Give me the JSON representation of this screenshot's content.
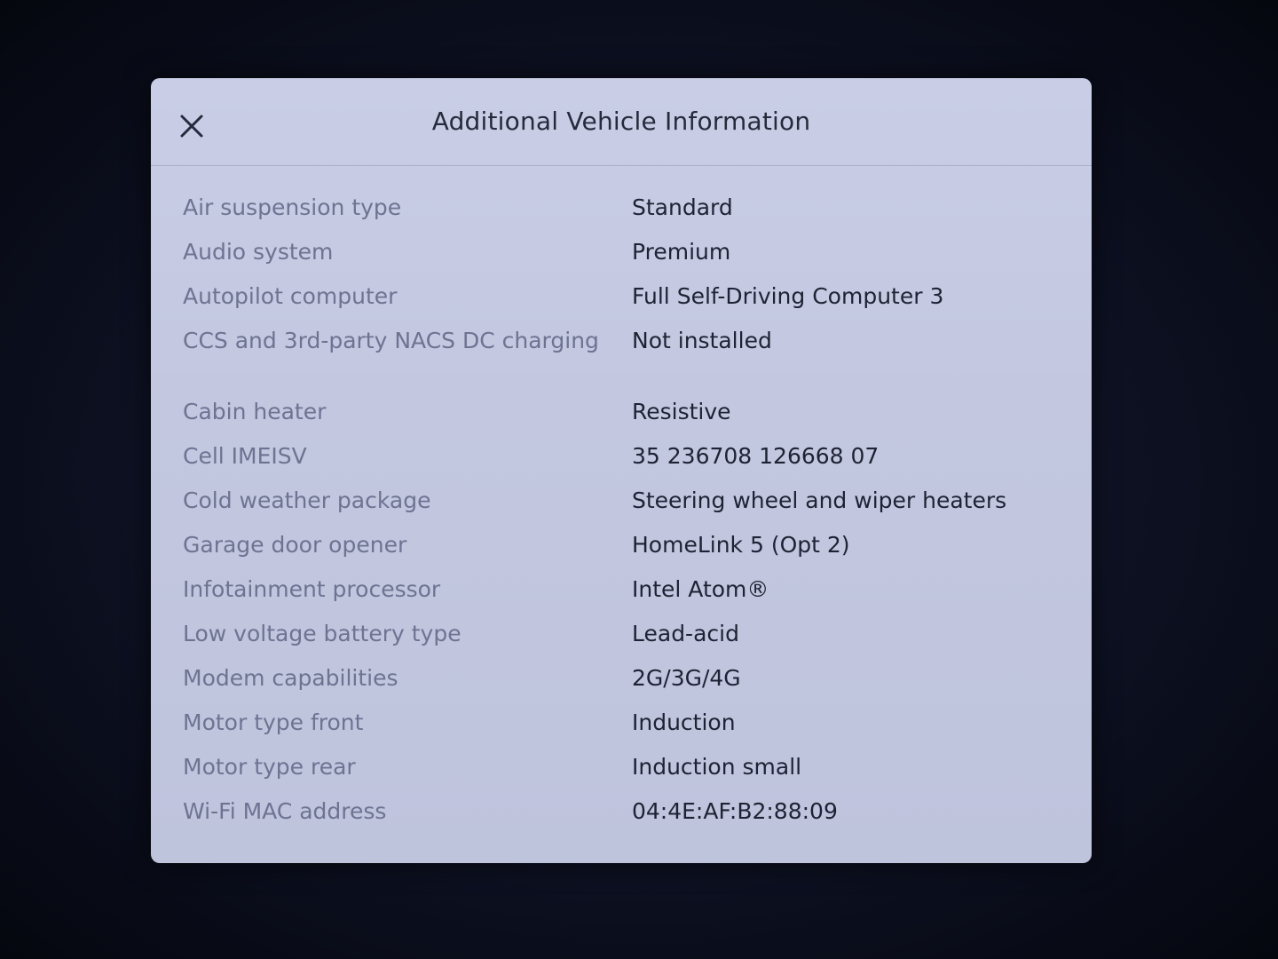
{
  "dialog": {
    "title": "Additional Vehicle Information",
    "close_icon": "close-icon"
  },
  "rows": [
    {
      "label": "Air suspension type",
      "value": "Standard"
    },
    {
      "label": "Audio system",
      "value": "Premium"
    },
    {
      "label": "Autopilot computer",
      "value": "Full Self-Driving Computer 3"
    },
    {
      "label": "CCS and 3rd-party NACS DC charging",
      "value": "Not installed"
    },
    {
      "label": "Cabin heater",
      "value": "Resistive"
    },
    {
      "label": "Cell IMEISV",
      "value": "35 236708 126668 07"
    },
    {
      "label": "Cold weather package",
      "value": "Steering wheel and wiper heaters"
    },
    {
      "label": "Garage door opener",
      "value": "HomeLink 5 (Opt 2)"
    },
    {
      "label": "Infotainment processor",
      "value": "Intel Atom®"
    },
    {
      "label": "Low voltage battery type",
      "value": "Lead-acid"
    },
    {
      "label": "Modem capabilities",
      "value": "2G/3G/4G"
    },
    {
      "label": "Motor type front",
      "value": "Induction"
    },
    {
      "label": "Motor type rear",
      "value": "Induction small"
    },
    {
      "label": "Wi-Fi MAC address",
      "value": "04:4E:AF:B2:88:09"
    }
  ]
}
